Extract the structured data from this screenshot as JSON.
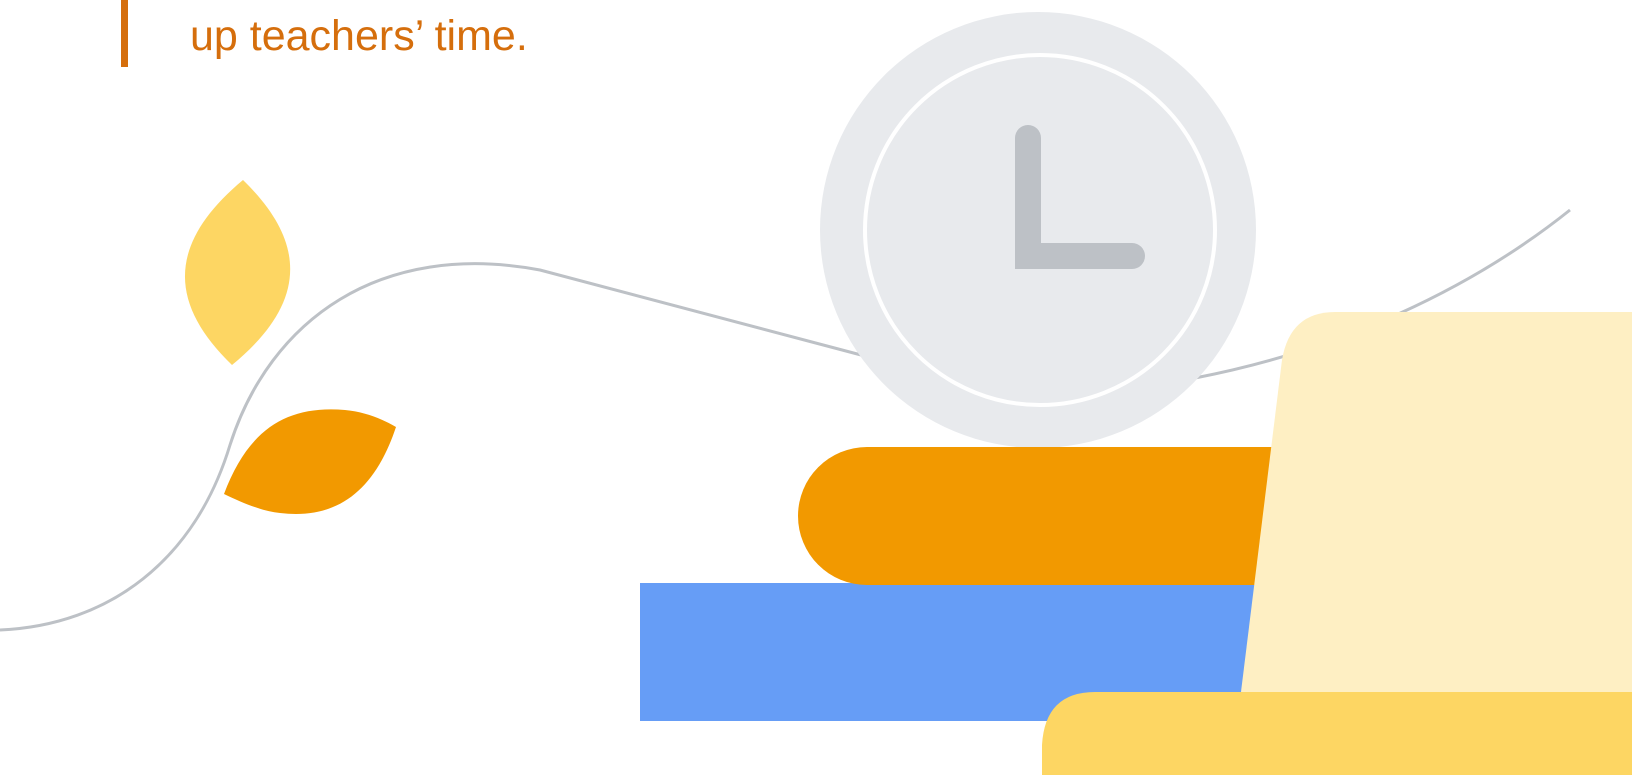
{
  "quote": {
    "text": "up teachers’ time."
  },
  "colors": {
    "accent": "#d56e0c",
    "leaf_light": "#fdd663",
    "leaf_dark": "#f29900",
    "line": "#bdc1c6",
    "clock_face": "#e8eaed",
    "clock_hands": "#bdc1c6",
    "book_orange": "#f29900",
    "book_blue": "#669df6",
    "laptop_screen": "#feefc3",
    "laptop_base": "#fdd663"
  },
  "icons": [
    "leaf-icon",
    "clock-icon",
    "books-icon",
    "laptop-icon"
  ]
}
